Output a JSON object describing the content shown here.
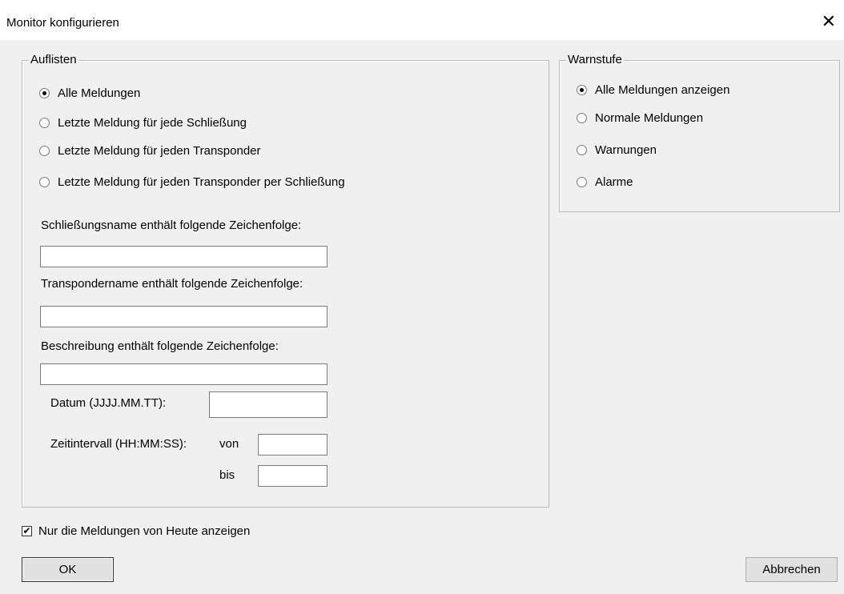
{
  "window": {
    "title": "Monitor konfigurieren",
    "close_glyph": "✕"
  },
  "list_group": {
    "legend": "Auflisten",
    "options": [
      {
        "label": "Alle Meldungen",
        "selected": true
      },
      {
        "label": "Letzte Meldung für jede Schließung",
        "selected": false
      },
      {
        "label": "Letzte Meldung für jeden Transponder",
        "selected": false
      },
      {
        "label": "Letzte Meldung für jeden Transponder per Schließung",
        "selected": false
      }
    ],
    "lock_name_label": "Schließungsname enthält folgende Zeichenfolge:",
    "lock_name_value": "",
    "transponder_name_label": "Transpondername enthält folgende Zeichenfolge:",
    "transponder_name_value": "",
    "description_label": "Beschreibung enthält folgende Zeichenfolge:",
    "description_value": "",
    "date_label": "Datum (JJJJ.MM.TT):",
    "date_value": "",
    "time_interval_label": "Zeitintervall (HH:MM:SS):",
    "from_label": "von",
    "from_value": "",
    "to_label": "bis",
    "to_value": ""
  },
  "warn_group": {
    "legend": "Warnstufe",
    "options": [
      {
        "label": "Alle Meldungen anzeigen",
        "selected": true
      },
      {
        "label": "Normale Meldungen",
        "selected": false
      },
      {
        "label": "Warnungen",
        "selected": false
      },
      {
        "label": "Alarme",
        "selected": false
      }
    ]
  },
  "today_only": {
    "label": "Nur die Meldungen von Heute anzeigen",
    "checked": true,
    "mark": "✔"
  },
  "buttons": {
    "ok": "OK",
    "cancel": "Abbrechen"
  }
}
